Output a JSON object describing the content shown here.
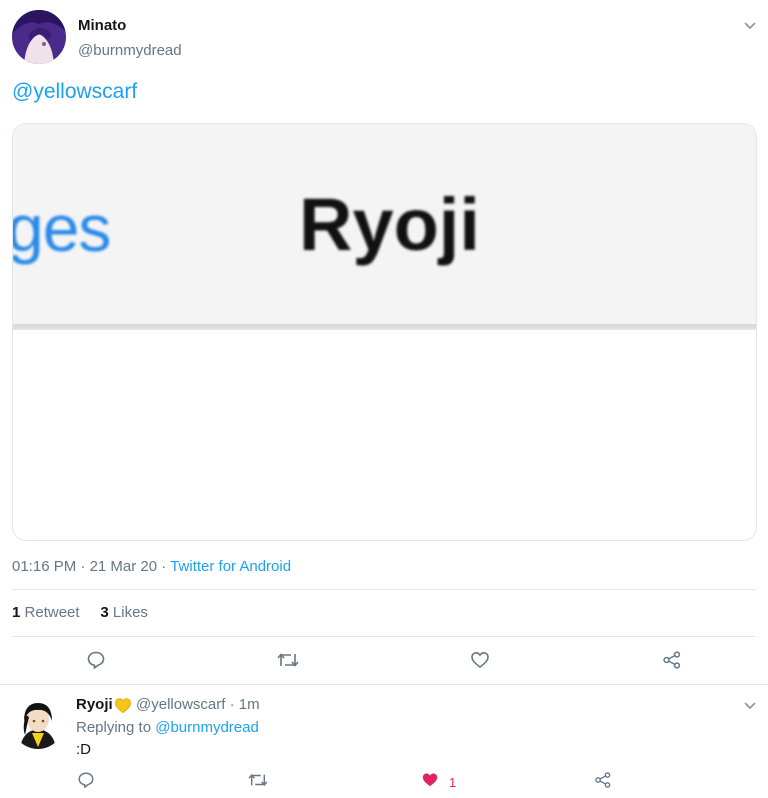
{
  "tweet": {
    "author_name": "Minato",
    "author_handle": "@burnmydread",
    "text_mention": "@yellowscarf",
    "media": {
      "text_left": "ges",
      "text_main": "Ryoji"
    },
    "time": "01:16 PM",
    "date": "21 Mar 20",
    "source": "Twitter for Android",
    "sep": "·",
    "retweet_count": "1",
    "retweet_label": "Retweet",
    "like_count": "3",
    "like_label": "Likes"
  },
  "reply": {
    "author_name": "Ryoji",
    "author_handle": "@yellowscarf",
    "time": "· 1m",
    "replying_to_label": "Replying to",
    "replying_to_handle": "@burnmydread",
    "text": ":D",
    "like_count": "1"
  },
  "icons": {
    "menu": "chevron-down-icon",
    "reply": "reply-icon",
    "retweet": "retweet-icon",
    "like": "heart-icon",
    "share": "share-icon",
    "badge": "yellow-heart-icon"
  },
  "colors": {
    "link": "#1da1f2",
    "secondary": "#657786",
    "like_active": "#e0245e",
    "divider": "#e1e8ed"
  }
}
